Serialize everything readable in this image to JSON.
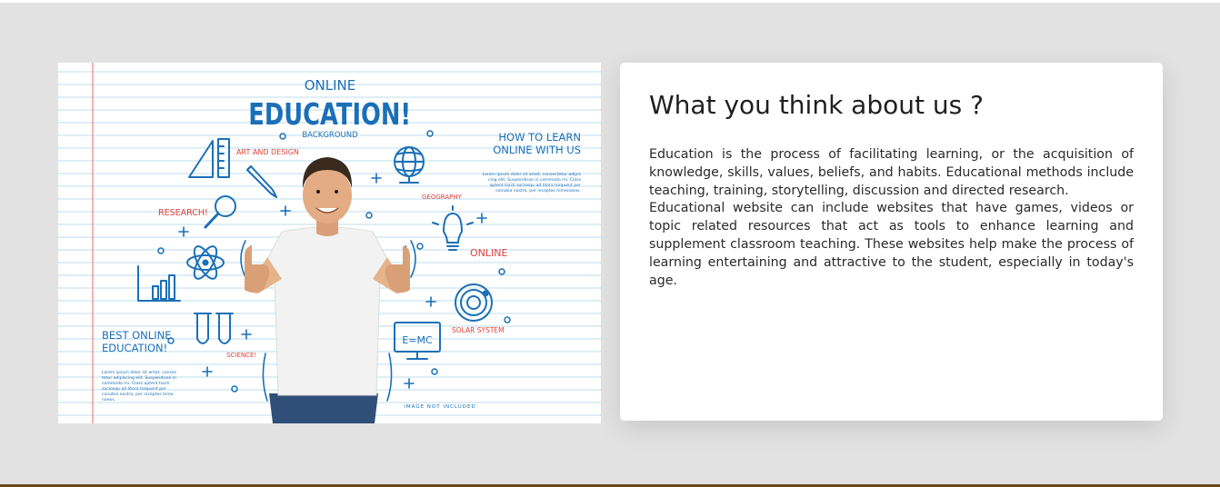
{
  "section": {
    "heading": "What you think about us ?",
    "paragraphs": [
      "Education is the process of facilitating learning, or the acquisition of knowledge, skills, values, beliefs, and habits. Educational methods include teaching, training, storytelling, discussion and directed research.",
      "Educational website can include websites that have games, videos or topic related resources that act as tools to enhance learning and supplement classroom teaching. These websites help make the process of learning entertaining and attractive to the student, especially in today's age."
    ]
  },
  "illustration": {
    "online": "ONLINE",
    "education": "EDUCATION!",
    "background": "BACKGROUND",
    "art_and_design": "ART AND DESIGN",
    "research": "RESEARCH!",
    "geography": "GEOGRAPHY",
    "online_label": "ONLINE",
    "how_to_learn_1": "HOW TO LEARN",
    "how_to_learn_2": "ONLINE WITH US",
    "best_online_1": "BEST ONLINE",
    "best_online_2": "EDUCATION!",
    "science": "SCIENCE!",
    "solar_system": "SOLAR SYSTEM",
    "formula": "E=MC",
    "image_not_included": "IMAGE NOT INCLUDED",
    "lorem_right": [
      "Lorem ipsum dolor sit amet, consectetur adipis",
      "cing elit. Suspendisse in commodo mi. Class",
      "aptent taciti sociosqu ad litora torquent per",
      "conubia nostra, per inceptos himenaeos."
    ],
    "lorem_left": [
      "Lorem ipsum dolor sit amet, consec",
      "tetur adipiscing elit. Suspendisse in",
      "commodo mi. Class aptent taciti",
      "sociosqu ad litora torquent per",
      "conubia nostra, per inceptos hime",
      "naeos."
    ]
  },
  "colors": {
    "blue": "#1b6fb8",
    "red": "#e0413a",
    "ruled_line": "#bcdcef",
    "margin_line": "#f09a9a"
  }
}
